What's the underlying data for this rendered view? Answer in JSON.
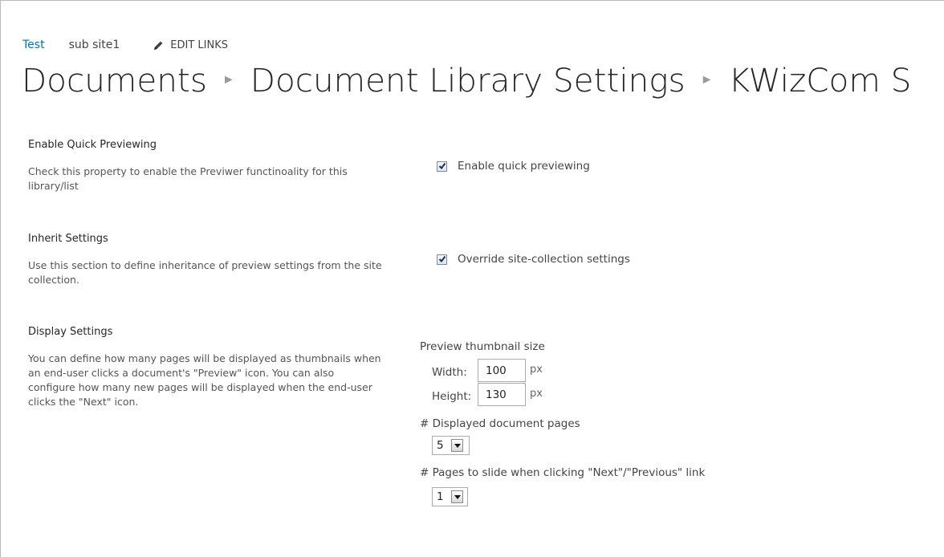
{
  "top_links": {
    "home": "Test",
    "subsite": "sub site1",
    "edit_links": "EDIT LINKS"
  },
  "breadcrumb": [
    {
      "label": "Documents"
    },
    {
      "label": "Document Library Settings"
    },
    {
      "label": "KWizCom S"
    }
  ],
  "sections": {
    "quick_preview": {
      "title": "Enable Quick Previewing",
      "description": "Check this property to enable the Previwer functinoality for this library/list",
      "checkbox_label": "Enable quick previewing",
      "checked": true
    },
    "inherit": {
      "title": "Inherit Settings",
      "description": "Use this section to define inheritance of preview settings from the site collection.",
      "checkbox_label": "Override site-collection settings",
      "checked": true
    },
    "display": {
      "title": "Display Settings",
      "description": "You can define how many pages will be displayed as thumbnails when an end-user clicks a document's \"Preview\" icon. You can also configure how many new pages will be displayed when the end-user clicks the \"Next\" icon.",
      "thumbnail_size_label": "Preview thumbnail size",
      "width_label": "Width:",
      "width_value": "100",
      "height_label": "Height:",
      "height_value": "130",
      "unit": "px",
      "displayed_pages_label": "# Displayed document pages",
      "displayed_pages_value": "5",
      "slide_pages_label": "# Pages to slide when clicking \"Next\"/\"Previous\" link",
      "slide_pages_value": "1"
    }
  },
  "icons": {
    "edit": "pencil-icon",
    "breadcrumb_separator": "chevron-right-icon",
    "checkbox": "checkmark-icon",
    "dropdown": "triangle-down-icon"
  },
  "colors": {
    "link": "#0072c6",
    "title": "#262626",
    "text": "#444444"
  }
}
